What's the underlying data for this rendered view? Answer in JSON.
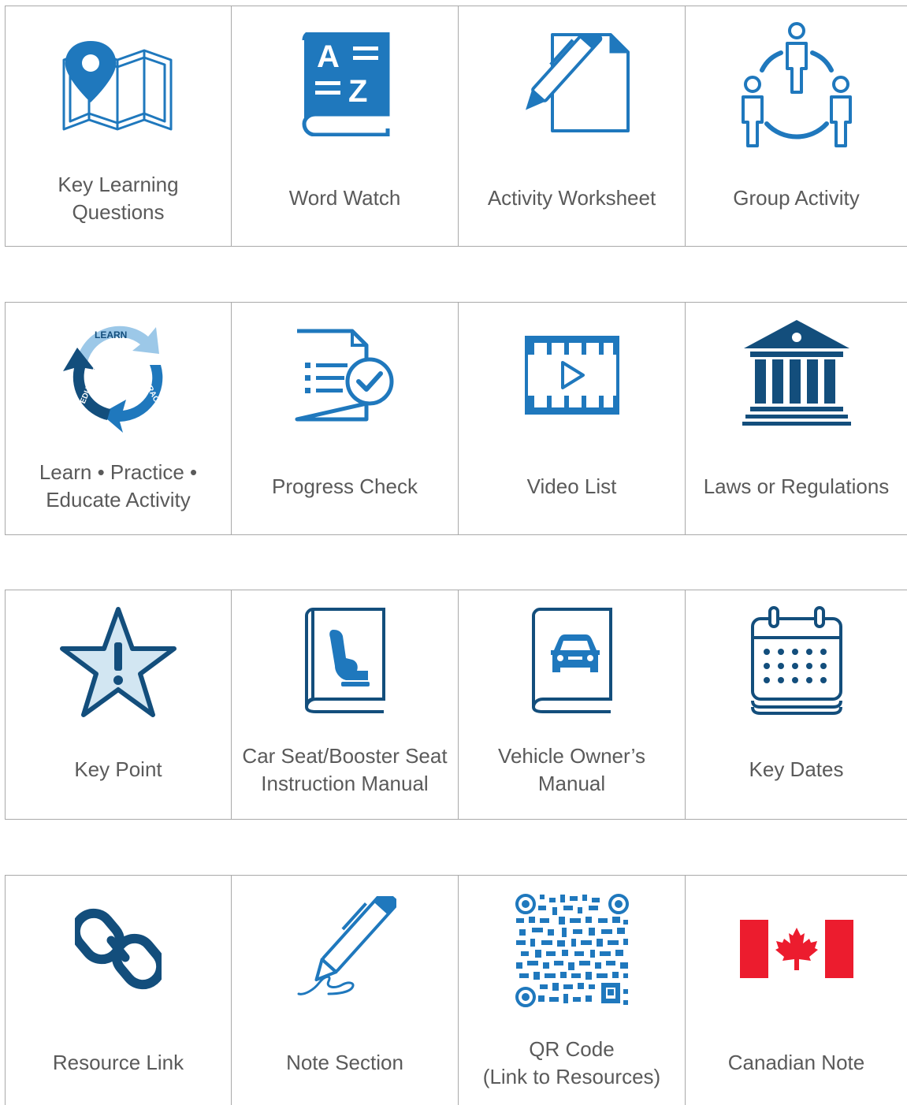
{
  "colors": {
    "primary_blue": "#1f78bd",
    "dark_blue": "#134e7c",
    "light_blue": "#d2e6f2",
    "canada_red": "#ec1c2e",
    "label_gray": "#5a5a5a",
    "border_gray": "#a9a9a9"
  },
  "rows": [
    [
      {
        "icon": "map-pin-icon",
        "label": "Key Learning\nQuestions"
      },
      {
        "icon": "dictionary-az-icon",
        "label": "Word Watch"
      },
      {
        "icon": "pen-document-icon",
        "label": "Activity Worksheet"
      },
      {
        "icon": "group-people-icon",
        "label": "Group Activity"
      }
    ],
    [
      {
        "icon": "learn-practice-educate-cycle-icon",
        "label": "Learn • Practice •\nEducate Activity",
        "cycle_words": [
          "LEARN",
          "PRACTICE",
          "EDUCATE"
        ]
      },
      {
        "icon": "document-checkmark-icon",
        "label": "Progress Check"
      },
      {
        "icon": "film-play-icon",
        "label": "Video List"
      },
      {
        "icon": "government-building-icon",
        "label": "Laws or Regulations"
      }
    ],
    [
      {
        "icon": "star-exclamation-icon",
        "label": "Key Point"
      },
      {
        "icon": "car-seat-manual-icon",
        "label": "Car Seat/Booster Seat\nInstruction Manual"
      },
      {
        "icon": "vehicle-manual-icon",
        "label": "Vehicle Owner’s\nManual"
      },
      {
        "icon": "calendar-icon",
        "label": "Key Dates"
      }
    ],
    [
      {
        "icon": "chain-link-icon",
        "label": "Resource Link"
      },
      {
        "icon": "pen-signature-icon",
        "label": "Note Section"
      },
      {
        "icon": "qr-code-icon",
        "label": "QR Code\n(Link to Resources)"
      },
      {
        "icon": "canada-flag-icon",
        "label": "Canadian Note"
      }
    ]
  ]
}
